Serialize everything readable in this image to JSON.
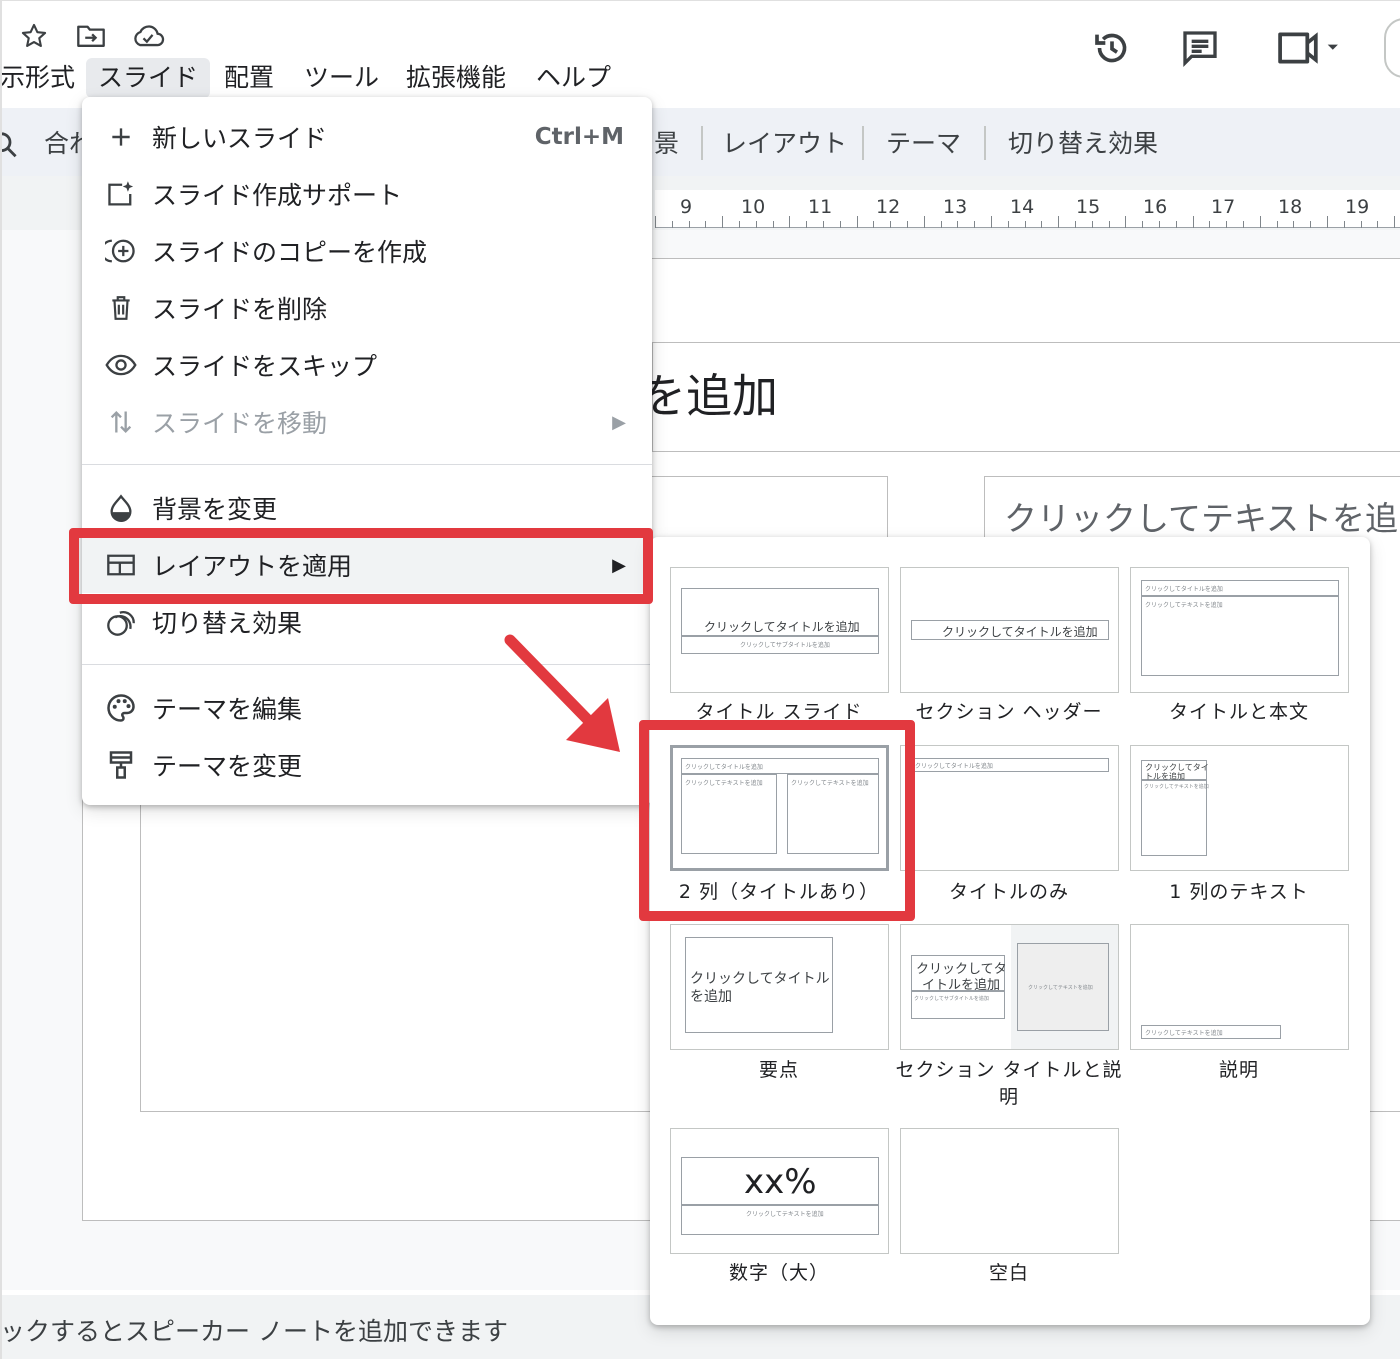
{
  "menubar": {
    "items": [
      "表示形式",
      "スライド",
      "配置",
      "ツール",
      "拡張機能",
      "ヘルプ"
    ],
    "partial_left": "示形式"
  },
  "toolbar": {
    "partial_left": "合わ",
    "partial_bg": "景",
    "layout": "レイアウト",
    "theme": "テーマ",
    "transition": "切り替え効果"
  },
  "ruler": {
    "labels": [
      "9",
      "10",
      "11",
      "12",
      "13",
      "14",
      "15",
      "16",
      "17",
      "18",
      "19"
    ]
  },
  "slide": {
    "title_partial": "を追加",
    "body_partial": "クリックしてテキストを追"
  },
  "notes": {
    "text": "ックするとスピーカー ノートを追加できます"
  },
  "menu": {
    "items": [
      {
        "label": "新しいスライド",
        "shortcut": "Ctrl+M",
        "icon": "plus-icon"
      },
      {
        "label": "スライド作成サポート",
        "icon": "sparkle-slide-icon"
      },
      {
        "label": "スライドのコピーを作成",
        "icon": "duplicate-icon"
      },
      {
        "label": "スライドを削除",
        "icon": "trash-icon"
      },
      {
        "label": "スライドをスキップ",
        "icon": "eye-icon"
      },
      {
        "label": "スライドを移動",
        "icon": "move-arrows-icon",
        "disabled": true
      },
      {
        "label": "背景を変更",
        "icon": "fill-drop-icon"
      },
      {
        "label": "レイアウトを適用",
        "icon": "layout-icon"
      },
      {
        "label": "切り替え効果",
        "icon": "transition-icon"
      },
      {
        "label": "テーマを編集",
        "icon": "palette-icon"
      },
      {
        "label": "テーマを変更",
        "icon": "paint-roller-icon"
      }
    ]
  },
  "layouts": {
    "items": [
      {
        "label": "タイトル スライド"
      },
      {
        "label": "セクション ヘッダー"
      },
      {
        "label": "タイトルと本文"
      },
      {
        "label": "2 列（タイトルあり）"
      },
      {
        "label": "タイトルのみ"
      },
      {
        "label": "1 列のテキスト"
      },
      {
        "label": "要点"
      },
      {
        "label": "セクション タイトルと説明"
      },
      {
        "label": "説明"
      },
      {
        "label": "数字（大）"
      },
      {
        "label": "空白"
      }
    ],
    "thumb_text": {
      "title": "クリックしてタイトルを追加",
      "subtitle": "クリックしてサブタイトルを追加",
      "text": "クリックしてテキストを追加",
      "title_wrap_a": "クリックしてタイトル",
      "title_wrap_b": "を追加",
      "section_a": "クリックしてタ",
      "section_b": "イトルを追加",
      "onecol_a": "クリックしてタイ",
      "onecol_b": "トルを追加",
      "number": "xx%"
    }
  },
  "colors": {
    "accent_red": "#e2393f",
    "toolbar_bg": "#eef1f6",
    "menu_bg": "#ffffff"
  }
}
